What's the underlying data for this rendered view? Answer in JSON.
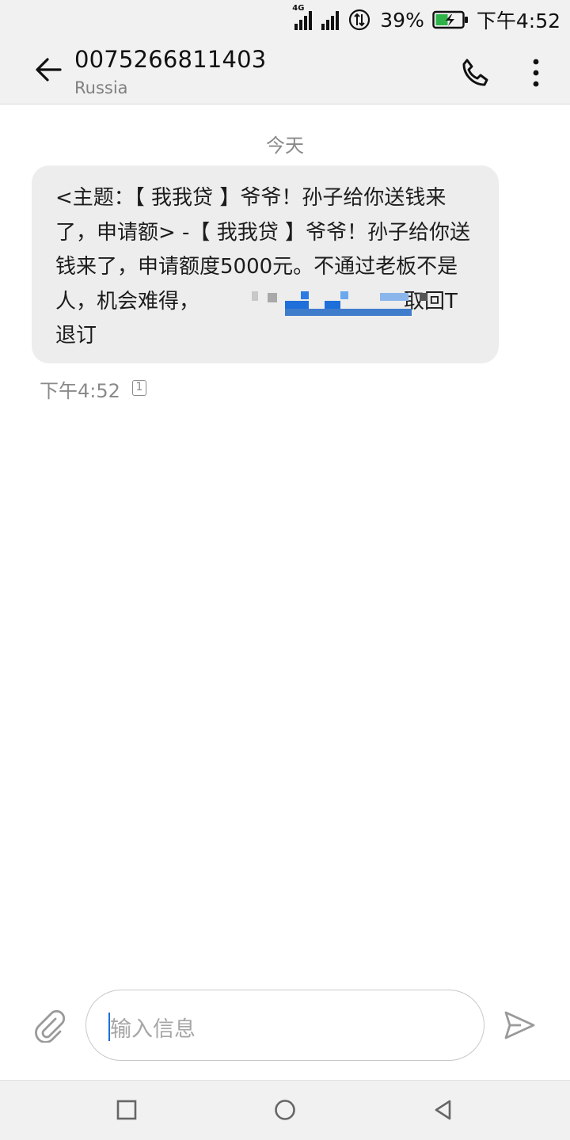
{
  "status_bar": {
    "network_label": "4G",
    "battery": "39%",
    "time": "下午4:52"
  },
  "header": {
    "contact_number": "0075266811403",
    "contact_region": "Russia",
    "back_icon": "arrow-left-icon",
    "call_icon": "phone-icon",
    "more_icon": "more-vertical-icon"
  },
  "conversation": {
    "date_divider": "今天",
    "messages": [
      {
        "text": "<主题：【 我我贷 】爷爷！孙子给你送钱来了，申请额> -【 我我贷 】爷爷！孙子给你送钱来了，申请额度5000元。不通过老板不是人，机会难得，",
        "text_tail": "取回T退订",
        "time": "下午4:52",
        "sim": "1"
      }
    ]
  },
  "composer": {
    "placeholder": "输入信息",
    "attach_icon": "paperclip-icon",
    "send_icon": "send-icon"
  },
  "colors": {
    "bar_bg": "#f1f1f1",
    "bubble_bg": "#ededed",
    "accent": "#1e6fd9",
    "muted_text": "#8a8a8a"
  }
}
